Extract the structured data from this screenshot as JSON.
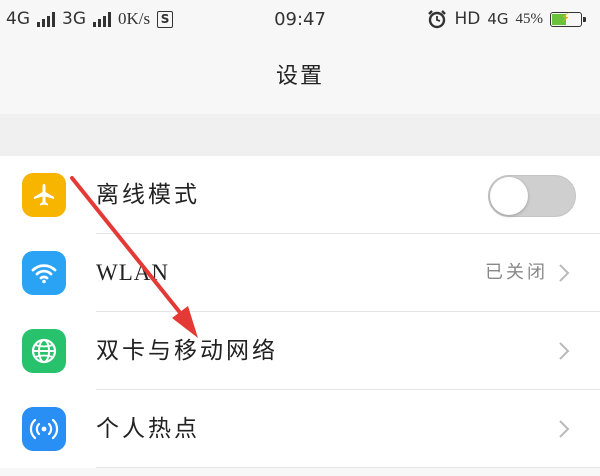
{
  "status_bar": {
    "net1": "4G",
    "net2": "3G",
    "speed": "0K/s",
    "s_icon": "S",
    "time": "09:47",
    "hd": "HD",
    "net3": "4G",
    "battery_percent": "45%",
    "battery_level": 0.45
  },
  "header": {
    "title": "设置"
  },
  "settings": {
    "airplane": {
      "label": "离线模式",
      "icon": "airplane-icon",
      "icon_color": "#f7b500",
      "enabled": false
    },
    "wlan": {
      "label": "WLAN",
      "value": "已关闭",
      "icon": "wifi-icon",
      "icon_color": "#2aa3f5"
    },
    "dual_sim": {
      "label": "双卡与移动网络",
      "icon": "globe-icon",
      "icon_color": "#27c26b"
    },
    "hotspot": {
      "label": "个人热点",
      "icon": "hotspot-icon",
      "icon_color": "#2a8ff5"
    }
  },
  "colors": {
    "arrow": "#e53935",
    "toggle_off": "#cfcfcf"
  }
}
